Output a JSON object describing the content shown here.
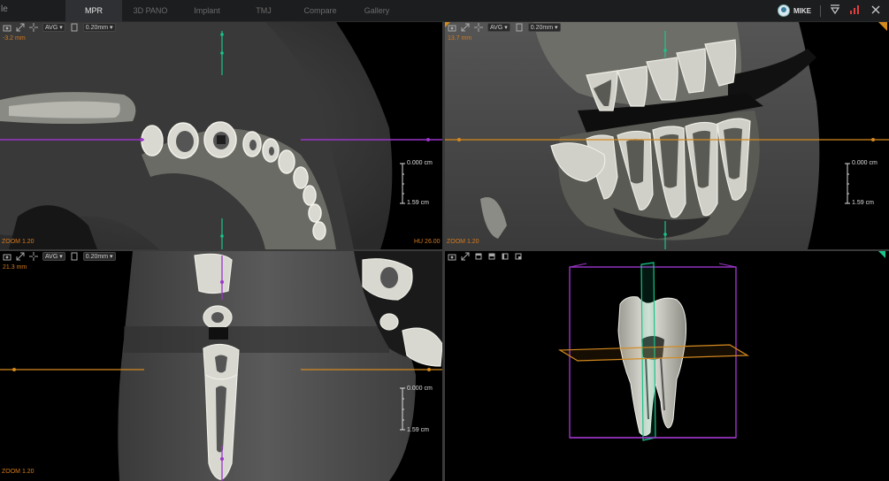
{
  "app": {
    "title_fragment": "le"
  },
  "tabs": [
    {
      "label": "MPR",
      "active": true
    },
    {
      "label": "3D PANO",
      "active": false
    },
    {
      "label": "Implant",
      "active": false
    },
    {
      "label": "TMJ",
      "active": false
    },
    {
      "label": "Compare",
      "active": false
    },
    {
      "label": "Gallery",
      "active": false
    }
  ],
  "user": {
    "name": "MIKE"
  },
  "toolbar_icons": [
    "filter-icon",
    "signal-bars-icon",
    "close-icon"
  ],
  "viewports": {
    "axial": {
      "mode": "AVG",
      "thickness": "0.20mm",
      "position": "-3.2 mm",
      "zoom": "ZOOM 1.20",
      "scale_top": "0.000 cm",
      "scale_bottom": "1.59 cm",
      "icons": [
        "camera-icon",
        "maximize-icon",
        "crosshair-icon",
        "slab-icon"
      ]
    },
    "coronal": {
      "mode": "AVG",
      "thickness": "0.20mm",
      "position": "13.7 mm",
      "zoom": "ZOOM 1.20",
      "hu": "HU 26.00",
      "scale_top": "0.000 cm",
      "scale_bottom": "1.59 cm",
      "icons": [
        "camera-icon",
        "maximize-icon",
        "crosshair-icon",
        "slab-icon"
      ]
    },
    "sagittal": {
      "mode": "AVG",
      "thickness": "0.20mm",
      "position": "21.3 mm",
      "zoom": "ZOOM 1.20",
      "scale_top": "0.000 cm",
      "scale_bottom": "1.59 cm",
      "icons": [
        "camera-icon",
        "maximize-icon",
        "crosshair-icon",
        "slab-icon"
      ]
    },
    "volume": {
      "icons": [
        "camera-icon",
        "maximize-icon",
        "cube-front-icon",
        "cube-top-icon",
        "cube-side-icon",
        "cube-iso-icon"
      ]
    }
  },
  "colors": {
    "purple_plane": "#9b35c8",
    "orange_plane": "#d58a1e",
    "green_plane": "#19c48a",
    "tooth": "#e0e0d8"
  }
}
